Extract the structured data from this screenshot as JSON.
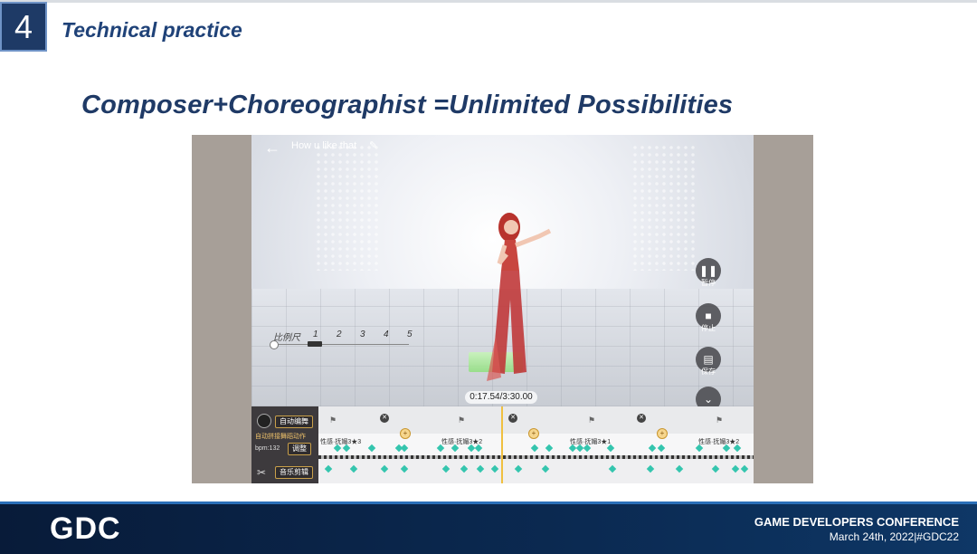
{
  "slide": {
    "section_number": "4",
    "section_title": "Technical practice",
    "headline": "Composer+Choreographist =Unlimited Possibilities"
  },
  "game": {
    "song_title": "How u like that",
    "scale": {
      "label": "比例尺",
      "marks": [
        "1",
        "2",
        "3",
        "4",
        "5"
      ]
    },
    "controls": [
      {
        "label": "暂停",
        "icon": "pause-icon"
      },
      {
        "label": "停止",
        "icon": "stop-icon"
      },
      {
        "label": "保存",
        "icon": "save-icon"
      }
    ],
    "time": "0:17.54/3:30.00",
    "timeline": {
      "auto_edit_label": "自动编舞",
      "auto_splice_text": "自动拼接舞蹈动作",
      "bpm": "bpm:132",
      "adjust_label": "调整",
      "music_edit_label": "音乐剪辑",
      "segments": [
        "性感·抚媚3★3",
        "性感·抚媚3★2",
        "性感·抚媚3★1",
        "性感·抚媚3★2"
      ]
    }
  },
  "footer": {
    "logo": "GDC",
    "conference": "GAME DEVELOPERS CONFERENCE",
    "date": "March 24th, 2022|#GDC22"
  },
  "colors": {
    "navy": "#1e3a66",
    "accent_teal": "#34c5ae",
    "timeline_gold": "#f0c040"
  }
}
